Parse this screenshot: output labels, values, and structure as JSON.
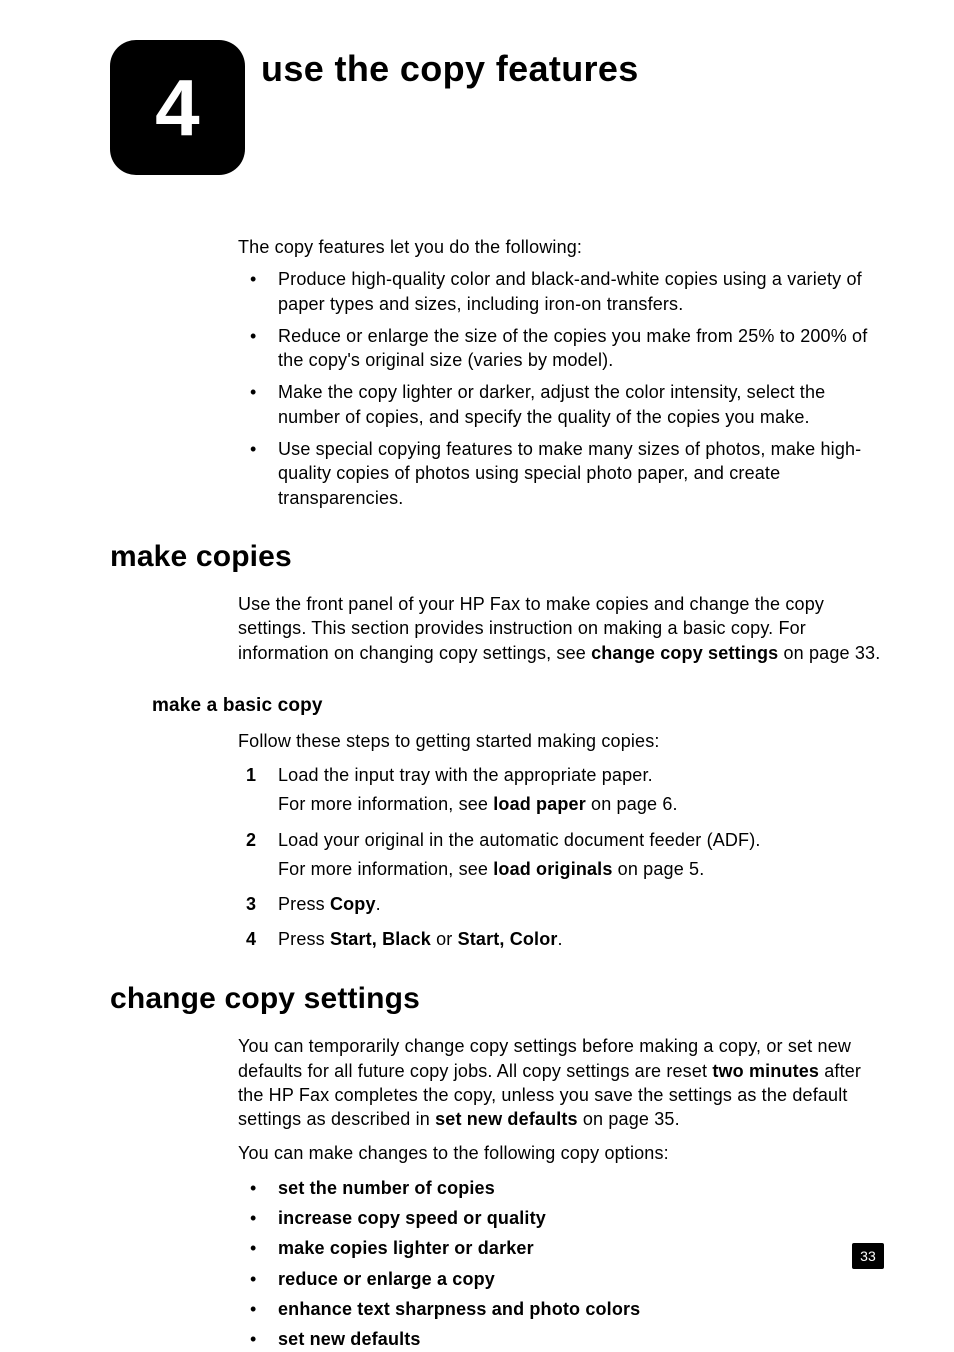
{
  "chapter": {
    "number": "4",
    "title": "use the copy features"
  },
  "intro": "The copy features let you do the following:",
  "intro_bullets": [
    "Produce high-quality color and black-and-white copies using a variety of paper types and sizes, including iron-on transfers.",
    "Reduce or enlarge the size of the copies you make from 25% to 200% of the copy's original size (varies by model).",
    "Make the copy lighter or darker, adjust the color intensity, select the number of copies, and specify the quality of the copies you make.",
    "Use special copying features to make many sizes of photos, make high-quality copies of photos using special photo paper, and create transparencies."
  ],
  "section1": {
    "heading": "make copies",
    "para_prefix": "Use the front panel of your HP Fax to make copies and change the copy settings. This section provides instruction on making a basic copy. For information on changing copy settings, see ",
    "para_bold": "change copy settings",
    "para_suffix": " on page 33.",
    "subsection": {
      "heading": "make a basic copy",
      "intro": "Follow these steps to getting started making copies:",
      "steps": {
        "s1": {
          "num": "1",
          "line1": "Load the input tray with the appropriate paper.",
          "line2_prefix": "For more information, see ",
          "line2_bold": "load paper",
          "line2_suffix": " on page 6."
        },
        "s2": {
          "num": "2",
          "line1": "Load your original in the automatic document feeder (ADF).",
          "line2_prefix": "For more information, see ",
          "line2_bold": "load originals",
          "line2_suffix": " on page 5."
        },
        "s3": {
          "num": "3",
          "prefix": "Press ",
          "bold": "Copy",
          "suffix": "."
        },
        "s4": {
          "num": "4",
          "prefix": "Press ",
          "bold1": "Start, Black",
          "mid": " or ",
          "bold2": "Start, Color",
          "suffix": "."
        }
      }
    }
  },
  "section2": {
    "heading": "change copy settings",
    "para1_prefix": "You can temporarily change copy settings before making a copy, or set new defaults for all future copy jobs. All copy settings are reset ",
    "para1_bold1": "two minutes",
    "para1_mid": " after the HP Fax completes the copy, unless you save the settings as the default settings as described in ",
    "para1_bold2": "set new defaults",
    "para1_suffix": " on page 35.",
    "para2": "You can make changes to the following copy options:",
    "options": [
      "set the number of copies",
      "increase copy speed or quality",
      "make copies lighter or darker",
      "reduce or enlarge a copy",
      "enhance text sharpness and photo colors",
      "set new defaults"
    ]
  },
  "page_number": "33"
}
